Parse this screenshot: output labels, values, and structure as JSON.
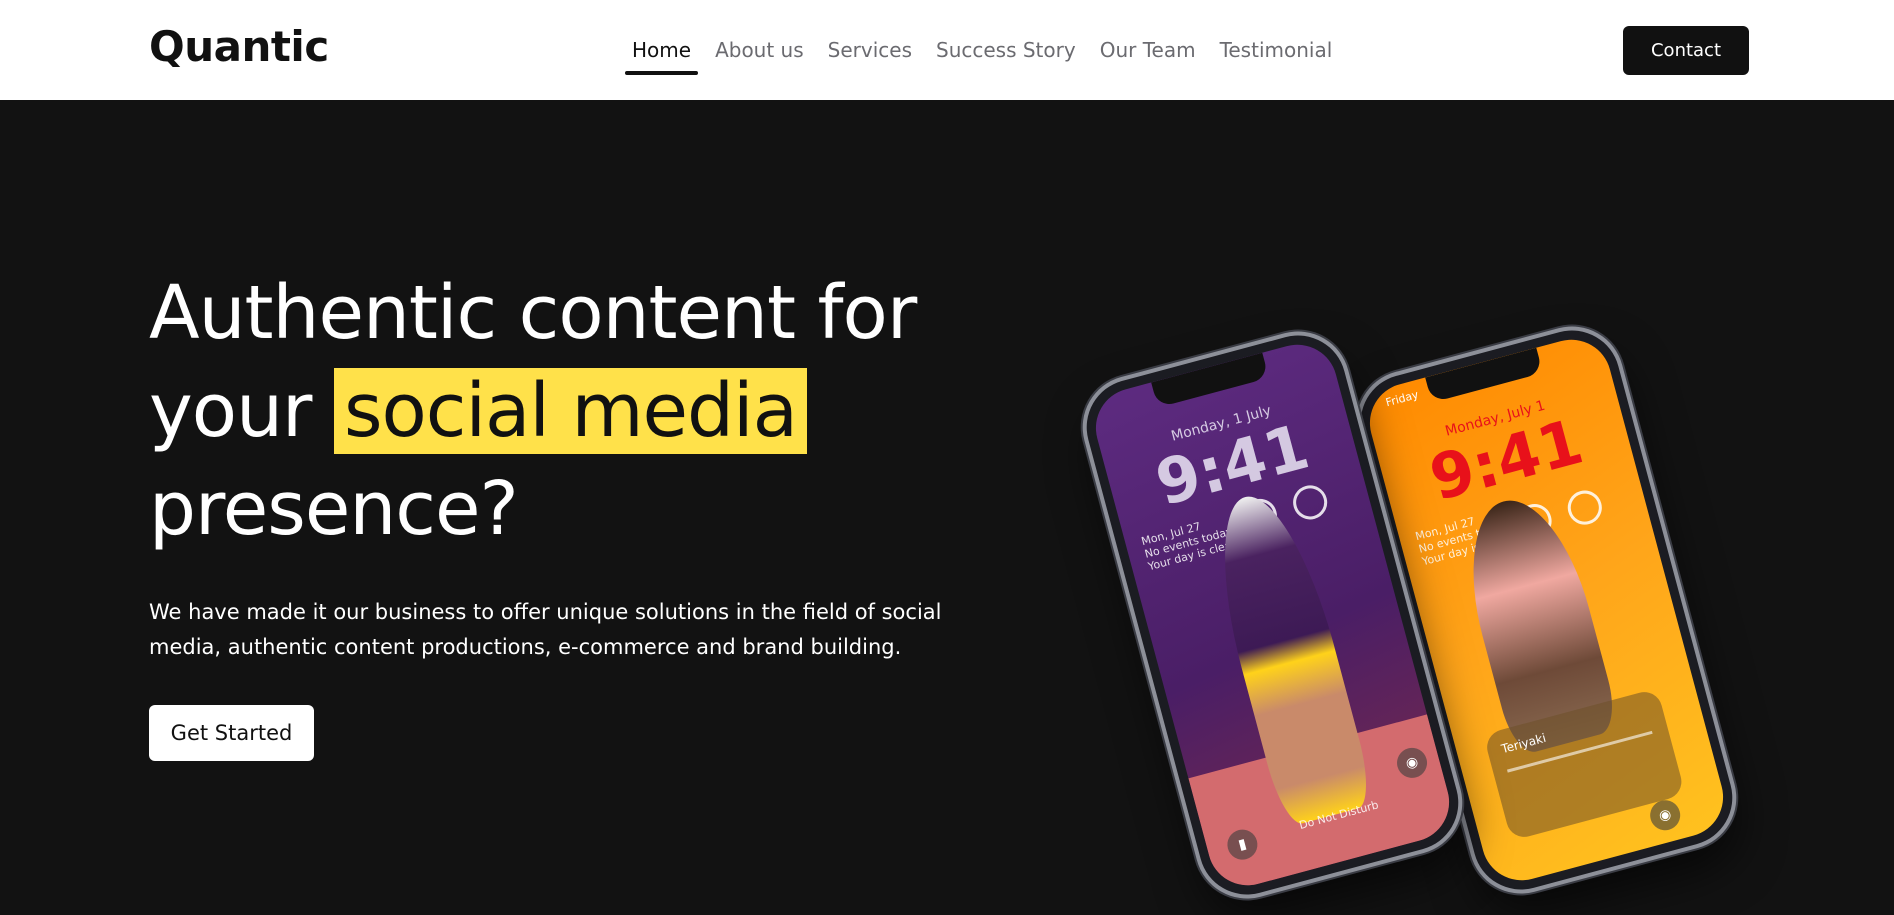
{
  "header": {
    "logo": "Quantic",
    "nav": [
      {
        "label": "Home",
        "active": true
      },
      {
        "label": "About us",
        "active": false
      },
      {
        "label": "Services",
        "active": false
      },
      {
        "label": "Success Story",
        "active": false
      },
      {
        "label": "Our Team",
        "active": false
      },
      {
        "label": "Testimonial",
        "active": false
      }
    ],
    "contact_label": "Contact"
  },
  "hero": {
    "headline_line1": "Authentic content for",
    "headline_pre": "your",
    "headline_highlight": "social media",
    "headline_line3": "presence?",
    "subtext": "We have made it our business to offer unique solutions in the field of social media, authentic content productions, e-commerce and brand building.",
    "cta_label": "Get Started"
  },
  "phones": {
    "front": {
      "date": "Monday, 1 July",
      "time": "9:41",
      "events": [
        "Mon, Jul 27",
        "No events today",
        "Your day is clear"
      ],
      "dnd": "Do Not Disturb"
    },
    "back": {
      "status": "Friday",
      "date": "Monday, July 1",
      "time": "9:41",
      "events": [
        "Mon, Jul 27",
        "No events today",
        "Your day is clear"
      ],
      "player": "Teriyaki"
    }
  },
  "colors": {
    "accent_yellow": "#ffe14a",
    "hero_bg": "#121212",
    "header_bg": "#ffffff",
    "button_dark": "#111111"
  }
}
